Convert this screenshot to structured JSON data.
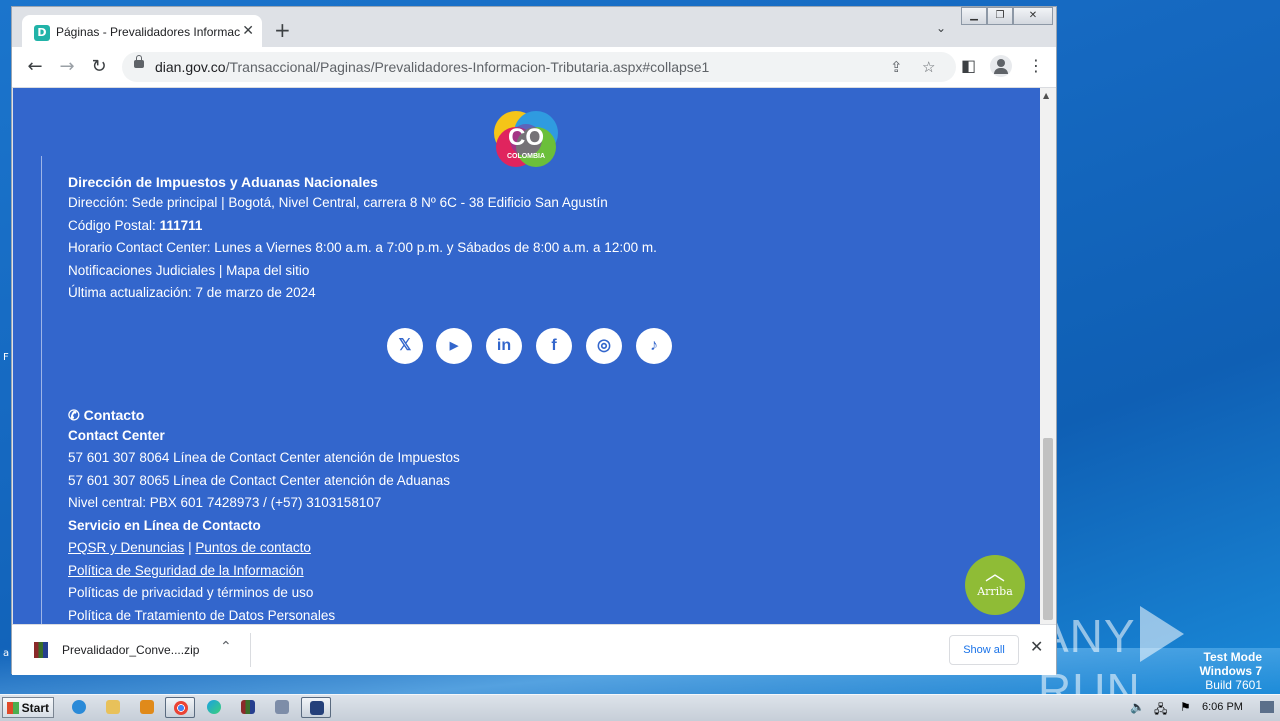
{
  "browser": {
    "tab_title": "Páginas - Prevalidadores Informacion Tributaria",
    "tab_favicon": "dian-favicon",
    "url_host": "dian.gov.co",
    "url_path": "/Transaccional/Paginas/Prevalidadores-Informacion-Tributaria.aspx#collapse1"
  },
  "footer": {
    "org_name": "Dirección de Impuestos y Aduanas Nacionales",
    "address": "Dirección: Sede principal | Bogotá, Nivel Central, carrera 8 Nº 6C - 38 Edificio San Agustín",
    "postal_label": "Código Postal: ",
    "postal_code": "111711",
    "hours": "Horario Contact Center: Lunes a Viernes 8:00 a.m. a 7:00 p.m. y Sábados de 8:00 a.m. a 12:00 m.",
    "notifications": "Notificaciones Judiciales | Mapa del sitio",
    "last_update": "Última actualización: 7 de marzo de 2024",
    "social": [
      {
        "name": "x-icon",
        "glyph": "𝕏"
      },
      {
        "name": "youtube-icon",
        "glyph": "▶"
      },
      {
        "name": "linkedin-icon",
        "glyph": "in"
      },
      {
        "name": "facebook-icon",
        "glyph": "f"
      },
      {
        "name": "instagram-icon",
        "glyph": "◎"
      },
      {
        "name": "tiktok-icon",
        "glyph": "♪"
      }
    ],
    "contact_title": "Contacto",
    "contact_center_title": "Contact Center",
    "phone1": "57 601 307 8064 Línea de Contact Center atención de Impuestos",
    "phone2": "57 601 307 8065 Línea de Contact Center atención de Aduanas",
    "central": "Nivel central: PBX 601 7428973 / (+57) 3103158107",
    "online_title": "Servicio en Línea de Contacto",
    "pqsr": "PQSR y Denuncias",
    "separator": " | ",
    "puntos": "Puntos de contacto",
    "security_policy": "Política de Seguridad de la Información",
    "privacy": "Políticas de privacidad y términos de uso",
    "data_policy": "Política de Tratamiento de Datos Personales",
    "logo_text": "CO",
    "logo_sub": "COLOMBIA"
  },
  "arriba_label": "Arriba",
  "download": {
    "file_name": "Prevalidador_Conve....zip",
    "show_all": "Show all"
  },
  "desktop": {
    "watermark_line1": "Test Mode",
    "watermark_line2": "Windows 7",
    "watermark_line3": "Build 7601",
    "anyrun_left": "ANY",
    "anyrun_right": "RUN",
    "edge_f": "F",
    "edge_a": "a"
  },
  "taskbar": {
    "start_label": "Start",
    "clock": "6:06 PM"
  }
}
